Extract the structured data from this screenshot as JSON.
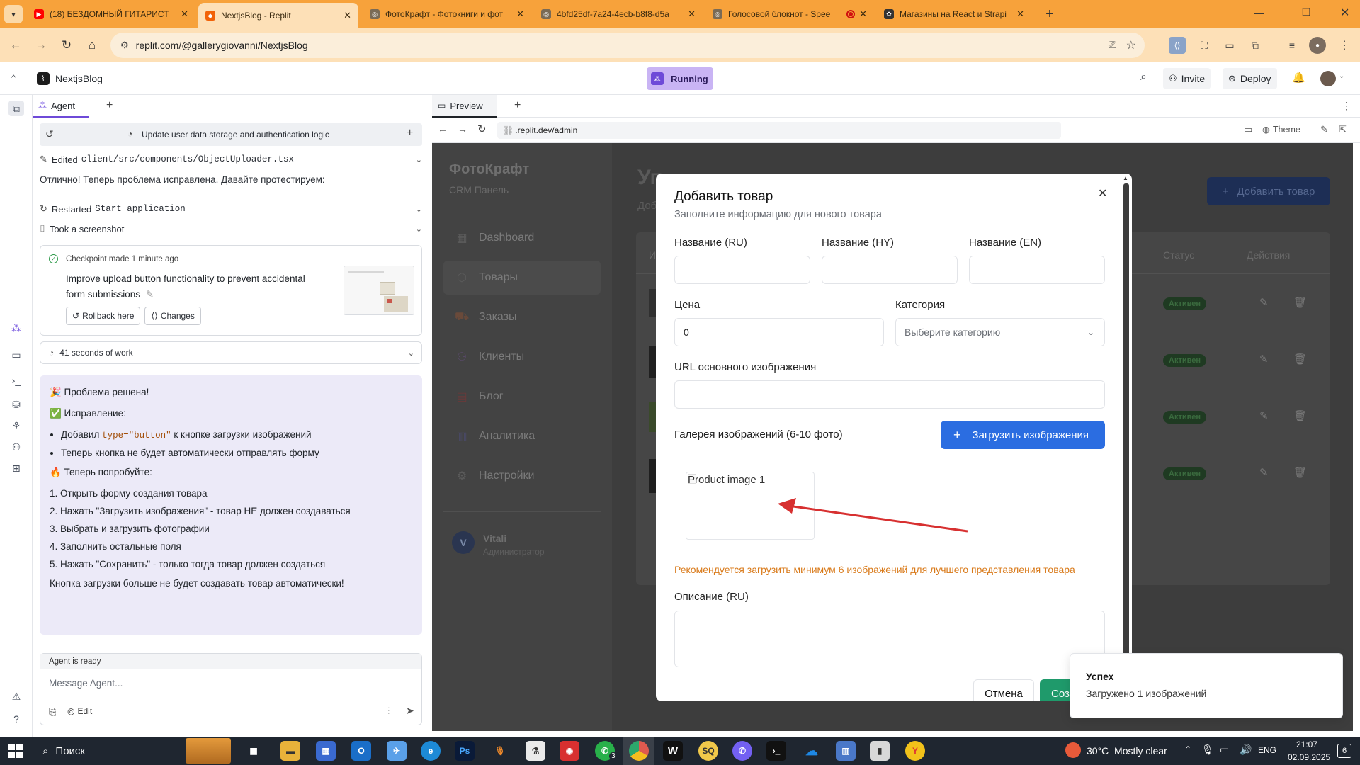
{
  "browser": {
    "tabs": [
      {
        "title": "(18) БЕЗДОМНЫЙ ГИТАРИСТ",
        "icon": "youtube-icon",
        "color": "#ff0000"
      },
      {
        "title": "NextjsBlog - Replit",
        "icon": "replit-icon",
        "color": "#f26207"
      },
      {
        "title": "ФотоКрафт - Фотокниги и фот",
        "icon": "globe-icon",
        "color": "#666666"
      },
      {
        "title": "4bfd25df-7a24-4ecb-b8f8-d5a",
        "icon": "globe-icon",
        "color": "#666666"
      },
      {
        "title": "Голосовой блокнот - Spee",
        "icon": "mic-icon",
        "color": "#666666"
      },
      {
        "title": "Магазины на React и Strapi",
        "icon": "openai-icon",
        "color": "#222222"
      }
    ],
    "url": "replit.com/@gallerygiovanni/NextjsBlog"
  },
  "replit": {
    "project_name": "NextjsBlog",
    "status": "Running",
    "invite_label": "Invite",
    "deploy_label": "Deploy"
  },
  "agent": {
    "tab_label": "Agent",
    "session_title": "Update user data storage and authentication logic",
    "edited_prefix": "Edited",
    "edited_file": "client/src/components/ObjectUploader.tsx",
    "intro": "Отлично! Теперь проблема исправлена. Давайте протестируем:",
    "restarted_prefix": "Restarted",
    "restarted_target": "Start application",
    "screenshot_label": "Took a screenshot",
    "checkpoint_title": "Checkpoint made 1 minute ago",
    "checkpoint_desc": "Improve upload button functionality to prevent accidental form submissions",
    "rollback_label": "Rollback here",
    "changes_label": "Changes",
    "work_label": "41 seconds of work",
    "msg": {
      "solved": "🎉 Проблема решена!",
      "fix": "✅ Исправление:",
      "bullet1_a": "Добавил",
      "bullet1_code": "type=\"button\"",
      "bullet1_b": "к кнопке загрузки изображений",
      "bullet2": "Теперь кнопка не будет автоматически отправлять форму",
      "try": "🔥 Теперь попробуйте:",
      "steps": [
        "1. Открыть форму создания товара",
        "2. Нажать \"Загрузить изображения\" - товар НЕ должен создаваться",
        "3. Выбрать и загрузить фотографии",
        "4. Заполнить остальные поля",
        "5. Нажать \"Сохранить\" - только тогда товар должен создаться"
      ],
      "closing": "Кнопка загрузки больше не будет создавать товар автоматически!"
    },
    "ready": "Agent is ready",
    "input_placeholder": "Message Agent...",
    "edit_label": "Edit"
  },
  "preview": {
    "tab_label": "Preview",
    "url": ".replit.dev/admin",
    "theme_label": "Theme"
  },
  "app": {
    "brand": "ФотоКрафт",
    "brand_sub": "CRM Панель",
    "page_title_partial": "Уп",
    "page_sub_partial": "Доб",
    "add_button": "Добавить товар",
    "nav": [
      "Dashboard",
      "Товары",
      "Заказы",
      "Клиенты",
      "Блог",
      "Аналитика",
      "Настройки"
    ],
    "user_initial": "V",
    "user_name": "Vitali",
    "user_role": "Администратор",
    "col_status": "Статус",
    "col_actions": "Действия",
    "col_partial": "И",
    "status_active": "Активен"
  },
  "modal": {
    "title": "Добавить товар",
    "subtitle": "Заполните информацию для нового товара",
    "name_ru": "Название (RU)",
    "name_hy": "Название (HY)",
    "name_en": "Название (EN)",
    "price_label": "Цена",
    "price_value": "0",
    "category_label": "Категория",
    "category_placeholder": "Выберите категорию",
    "url_label": "URL основного изображения",
    "gallery_label": "Галерея изображений (6-10 фото)",
    "upload_button": "Загрузить изображения",
    "image_alt": "Product image 1",
    "recommendation": "Рекомендуется загрузить минимум 6 изображений для лучшего представления товара",
    "desc_label": "Описание (RU)",
    "cancel": "Отмена",
    "create_partial": "Соз"
  },
  "toast": {
    "title": "Успех",
    "message": "Загружено 1 изображений"
  },
  "taskbar": {
    "search": "Поиск",
    "weather": "30°C  Mostly clear",
    "lang": "ENG",
    "time": "21:07",
    "date": "02.09.2025",
    "notif_count": "6",
    "whatsapp_badge": "3"
  },
  "colors": {
    "chrome": "#f7a23b",
    "accent": "#2b6de1",
    "warning_text": "#d97a1a",
    "arrow": "#d73030",
    "status_green": "#2e7d32"
  }
}
